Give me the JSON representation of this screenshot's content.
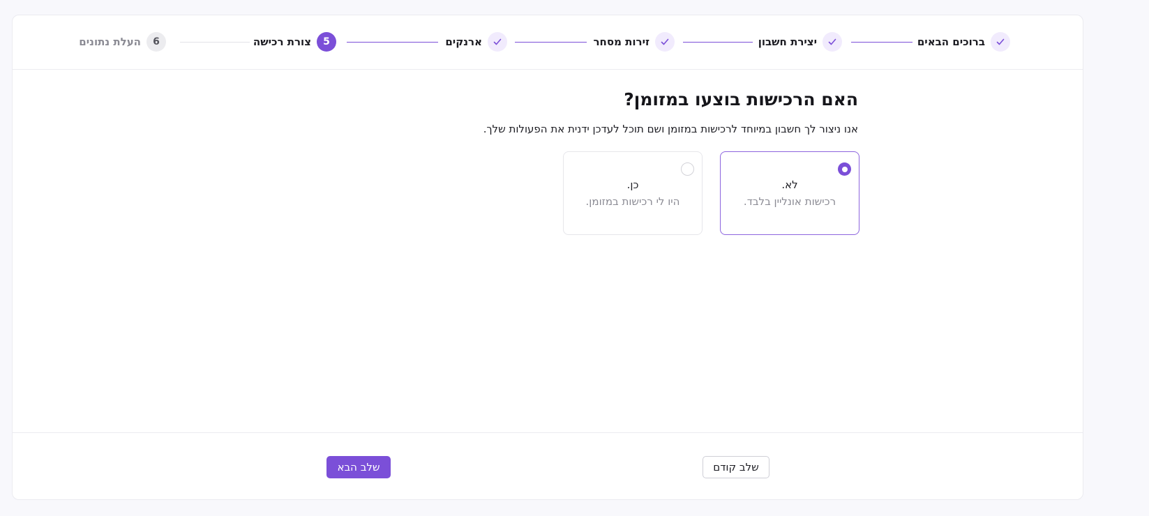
{
  "stepper": {
    "steps": [
      {
        "label": "ברוכים הבאים",
        "state": "done",
        "icon": "check-icon"
      },
      {
        "label": "יצירת חשבון",
        "state": "done",
        "icon": "check-icon"
      },
      {
        "label": "זירות מסחר",
        "state": "done",
        "icon": "check-icon"
      },
      {
        "label": "ארנקים",
        "state": "done",
        "icon": "check-icon"
      },
      {
        "label": "צורת רכישה",
        "state": "current",
        "number": "5"
      },
      {
        "label": "העלת נתונים",
        "state": "pending",
        "number": "6"
      }
    ]
  },
  "main": {
    "title": "האם הרכישות בוצעו במזומן?",
    "subtitle": "אנו ניצור לך חשבון במיוחד לרכישות במזומן ושם תוכל לעדכן ידנית את הפעולות שלך.",
    "options": [
      {
        "title": "לא.",
        "description": "רכישות אונליין בלבד.",
        "selected": true
      },
      {
        "title": "כן.",
        "description": "היו לי רכישות במזומן.",
        "selected": false
      }
    ]
  },
  "footer": {
    "prev_label": "שלב קודם",
    "next_label": "שלב הבא"
  },
  "colors": {
    "accent": "#7b4fd8",
    "accent_light": "#f1ebfd",
    "background": "#f8f8fc"
  }
}
